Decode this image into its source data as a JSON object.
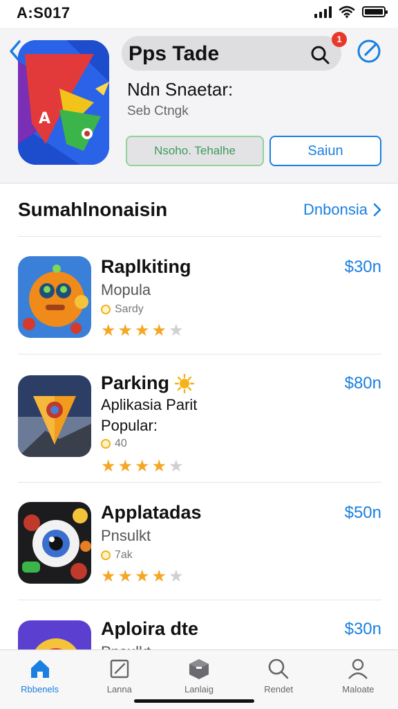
{
  "status_bar": {
    "time": "A:S017"
  },
  "header": {
    "search_title": "Pps Tade",
    "notification_count": "1",
    "app_name": "Ndn Snaetar:",
    "app_subtitle": "Seb Ctngk",
    "primary_button": "Nsoho. Tehalhe",
    "secondary_button": "Saiun"
  },
  "section": {
    "title": "Sumahlnonaisin",
    "see_all": "Dnbonsia"
  },
  "apps": [
    {
      "title": "Raplkiting",
      "subtitle": "Mopula",
      "meta": "Sardy",
      "rating": 4,
      "price": "$30n"
    },
    {
      "title": "Parking",
      "subtitle": "Aplikasia Parit",
      "subtitle2": "Popular:",
      "meta": "40",
      "rating": 4,
      "price": "$80n"
    },
    {
      "title": "Applatadas",
      "subtitle": "Pnsulkt",
      "meta": "7ak",
      "rating": 4,
      "price": "$50n"
    },
    {
      "title": "Aploira dte",
      "subtitle": "Pnsulkt",
      "price": "$30n"
    }
  ],
  "tabs": [
    {
      "label": "Rbbenels",
      "icon": "home-icon"
    },
    {
      "label": "Lanna",
      "icon": "edit-icon"
    },
    {
      "label": "Lanlaig",
      "icon": "box-icon"
    },
    {
      "label": "Rendet",
      "icon": "search-icon"
    },
    {
      "label": "Maloate",
      "icon": "person-icon"
    }
  ],
  "colors": {
    "accent": "#1a7fe0",
    "star": "#f5a623",
    "star_empty": "#cfcfd4",
    "badge": "#e8382c"
  }
}
